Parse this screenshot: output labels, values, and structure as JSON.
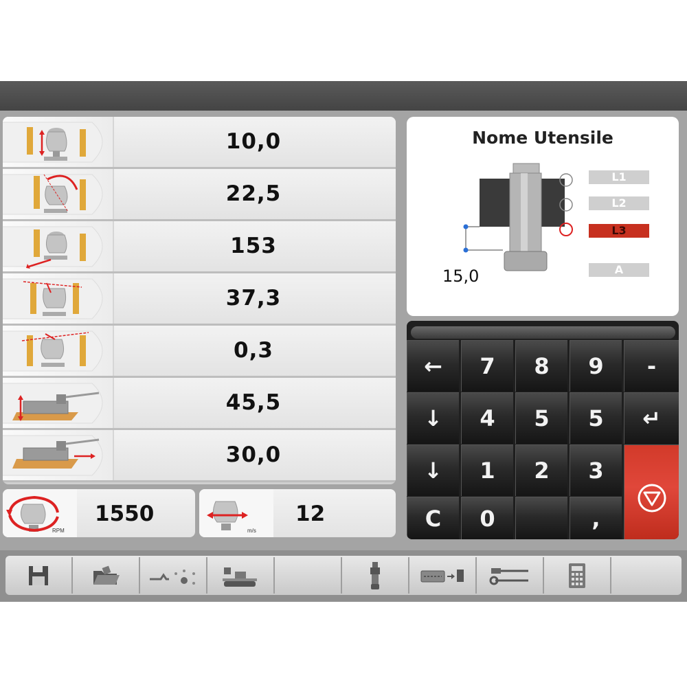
{
  "params": [
    {
      "name": "param-vertical-offset",
      "value": "10,0"
    },
    {
      "name": "param-tilt-angle",
      "value": "22,5"
    },
    {
      "name": "param-horizontal-offset",
      "value": "153"
    },
    {
      "name": "param-top-offset",
      "value": "37,3"
    },
    {
      "name": "param-angle-offset",
      "value": "0,3"
    },
    {
      "name": "param-carriage-height",
      "value": "45,5"
    },
    {
      "name": "param-carriage-travel",
      "value": "30,0"
    }
  ],
  "spindle": {
    "value": "1550",
    "unit": "RPM"
  },
  "feed": {
    "value": "12",
    "unit": "m/s"
  },
  "tool": {
    "title": "Nome Utensile",
    "levels": [
      "L1",
      "L2",
      "L3",
      "A"
    ],
    "active_level": "L3",
    "dimension": "15,0"
  },
  "keypad": {
    "keys": [
      "←",
      "7",
      "8",
      "9",
      "-",
      "↓",
      "4",
      "5",
      "5",
      "↵",
      "↓",
      "1",
      "2",
      "3",
      "C",
      "0",
      ","
    ]
  },
  "colors": {
    "accent": "#c7301f",
    "keypad": "#1f1f1f",
    "panel": "#e8e8e8"
  },
  "toolbar": {
    "icons": [
      "save-icon",
      "open-folder-icon",
      "tool-path-icon",
      "machine-lock-icon",
      "empty-slot",
      "spindle-tool-icon",
      "keyboard-export-icon",
      "wrench-settings-icon",
      "calculator-icon",
      "empty-slot"
    ]
  }
}
